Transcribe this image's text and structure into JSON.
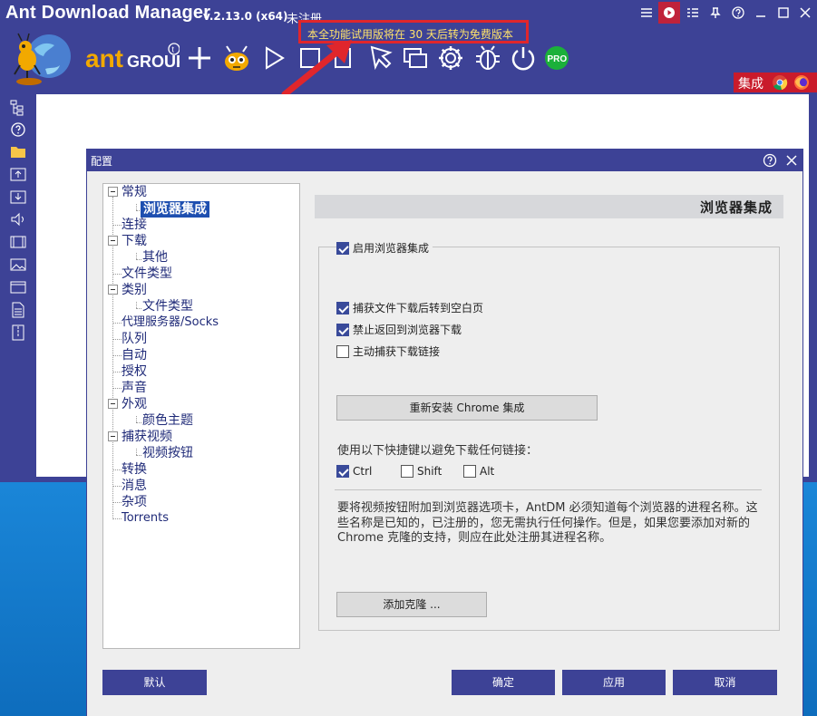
{
  "app": {
    "title": "Ant Download Manager",
    "version": "v.2.13.0 (x64)",
    "unregistered": "未注册",
    "trial_notice": "本全功能试用版将在 30 天后转为免费版本",
    "integration_label": "集成"
  },
  "colors": {
    "chrome": "#3d4296",
    "accent_red": "#c91b2b",
    "notice_border": "#e0262c",
    "notice_text": "#ffe36a",
    "selection": "#1e4fb0"
  },
  "toolbar_icons": [
    "ant-logo-icon",
    "antgroup-logo",
    "add-icon",
    "ant-mascot-icon",
    "play-icon",
    "stop-icon",
    "pause-icon",
    "cursor-icon",
    "windows-icon",
    "gear-icon",
    "bug-icon",
    "power-icon",
    "pro-icon"
  ],
  "dialog": {
    "title": "配置",
    "section_title": "浏览器集成",
    "enable_label": "启用浏览器集成",
    "options": [
      {
        "label": "捕获文件下载后转到空白页",
        "checked": true
      },
      {
        "label": "禁止返回到浏览器下载",
        "checked": true
      },
      {
        "label": "主动捕获下载链接",
        "checked": false
      }
    ],
    "reinstall_label": "重新安装 Chrome 集成",
    "shortcut_label": "使用以下快捷键以避免下载任何链接：",
    "keys": [
      {
        "label": "Ctrl",
        "checked": true
      },
      {
        "label": "Shift",
        "checked": false
      },
      {
        "label": "Alt",
        "checked": false
      }
    ],
    "description": "要将视频按钮附加到浏览器选项卡，AntDM 必须知道每个浏览器的进程名称。这些名称是已知的，已注册的，您无需执行任何操作。但是，如果您要添加对新的 Chrome 克隆的支持，则应在此处注册其进程名称。",
    "add_clone_label": "添加克隆 ...",
    "footer": {
      "default": "默认",
      "ok": "确定",
      "apply": "应用",
      "cancel": "取消"
    }
  },
  "tree": [
    {
      "label": "常规"
    },
    {
      "label": "浏览器集成",
      "selected": true
    },
    {
      "label": "连接"
    },
    {
      "label": "下载"
    },
    {
      "label": "其他"
    },
    {
      "label": "文件类型"
    },
    {
      "label": "类别"
    },
    {
      "label": "文件类型"
    },
    {
      "label": "代理服务器/Socks"
    },
    {
      "label": "队列"
    },
    {
      "label": "自动"
    },
    {
      "label": "授权"
    },
    {
      "label": "声音"
    },
    {
      "label": "外观"
    },
    {
      "label": "颜色主题"
    },
    {
      "label": "捕获视频"
    },
    {
      "label": "视频按钮"
    },
    {
      "label": "转换"
    },
    {
      "label": "消息"
    },
    {
      "label": "杂项"
    },
    {
      "label": "Torrents"
    }
  ]
}
